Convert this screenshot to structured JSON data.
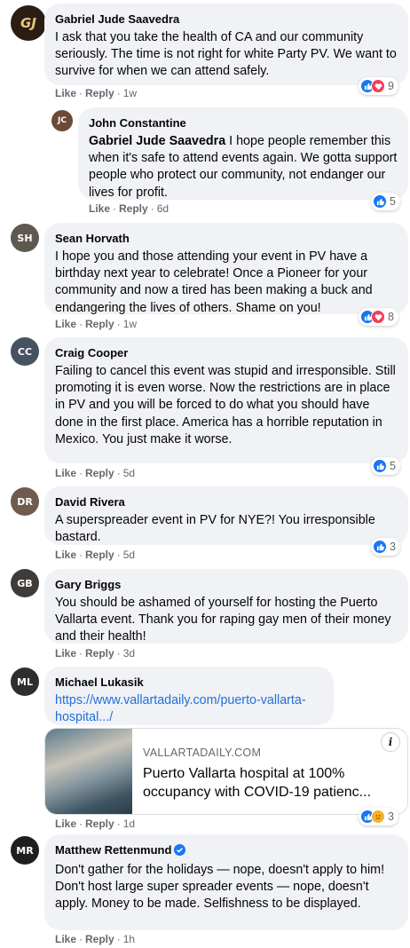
{
  "colors": {
    "bubble": "#f0f2f5",
    "like_blue": "#1877f2",
    "love_red": "#f33e58",
    "haha_yellow": "#f7b125",
    "link": "#216fdb",
    "meta_gray": "#65676b"
  },
  "actions": {
    "like": "Like",
    "reply": "Reply",
    "sep": "·"
  },
  "comments": [
    {
      "author": "Gabriel Jude Saavedra",
      "text": "I ask that you take the health of CA and our community seriously. The time is not right for white Party PV. We want to survive for when we can attend safely.",
      "time": "1w",
      "reaction_icons": [
        "like-icon",
        "love-icon"
      ],
      "reaction_count": "9"
    },
    {
      "author": "John Constantine",
      "mention": "Gabriel Jude Saavedra",
      "text": " I hope people remember this when it's safe to attend events again. We gotta support people who protect our community, not endanger our lives for profit.",
      "time": "6d",
      "reaction_icons": [
        "like-icon"
      ],
      "reaction_count": "5"
    },
    {
      "author": "Sean Horvath",
      "text": "I hope you and those attending your event in PV have a birthday next year to celebrate! Once a Pioneer for your community and now a tired has been making a buck and endangering the lives of others. Shame on you!",
      "time": "1w",
      "reaction_icons": [
        "like-icon",
        "love-icon"
      ],
      "reaction_count": "8"
    },
    {
      "author": "Craig Cooper",
      "text": "Failing to cancel this event was stupid and irresponsible. Still promoting it is even worse. Now the restrictions are in place in PV and you will be forced to do what you should have done in the first place. America has a horrible reputation in Mexico. You just make it worse.",
      "time": "5d",
      "reaction_icons": [
        "like-icon"
      ],
      "reaction_count": "5"
    },
    {
      "author": "David Rivera",
      "text": "A superspreader event in PV for NYE?! You irresponsible bastard.",
      "time": "5d",
      "reaction_icons": [
        "like-icon"
      ],
      "reaction_count": "3"
    },
    {
      "author": "Gary Briggs",
      "text": "You should be ashamed of yourself for hosting the Puerto Vallarta event. Thank you for raping gay men of their money and their health!",
      "time": "3d"
    },
    {
      "author": "Michael Lukasik",
      "link_text": "https://www.vallartadaily.com/puerto-vallarta-hospital.../",
      "time": "1d",
      "preview": {
        "site": "VALLARTADAILY.COM",
        "title": "Puerto Vallarta hospital at 100% occupancy with COVID-19 patienc..."
      },
      "reaction_icons": [
        "like-icon",
        "sad-icon"
      ],
      "reaction_count": "3"
    },
    {
      "author": "Matthew Rettenmund",
      "text": "Don't gather for the holidays — nope, doesn't apply to him! Don't host large super spreader events — nope, doesn't apply. Money to be made. Selfishness to be displayed.",
      "time": "1h"
    }
  ]
}
